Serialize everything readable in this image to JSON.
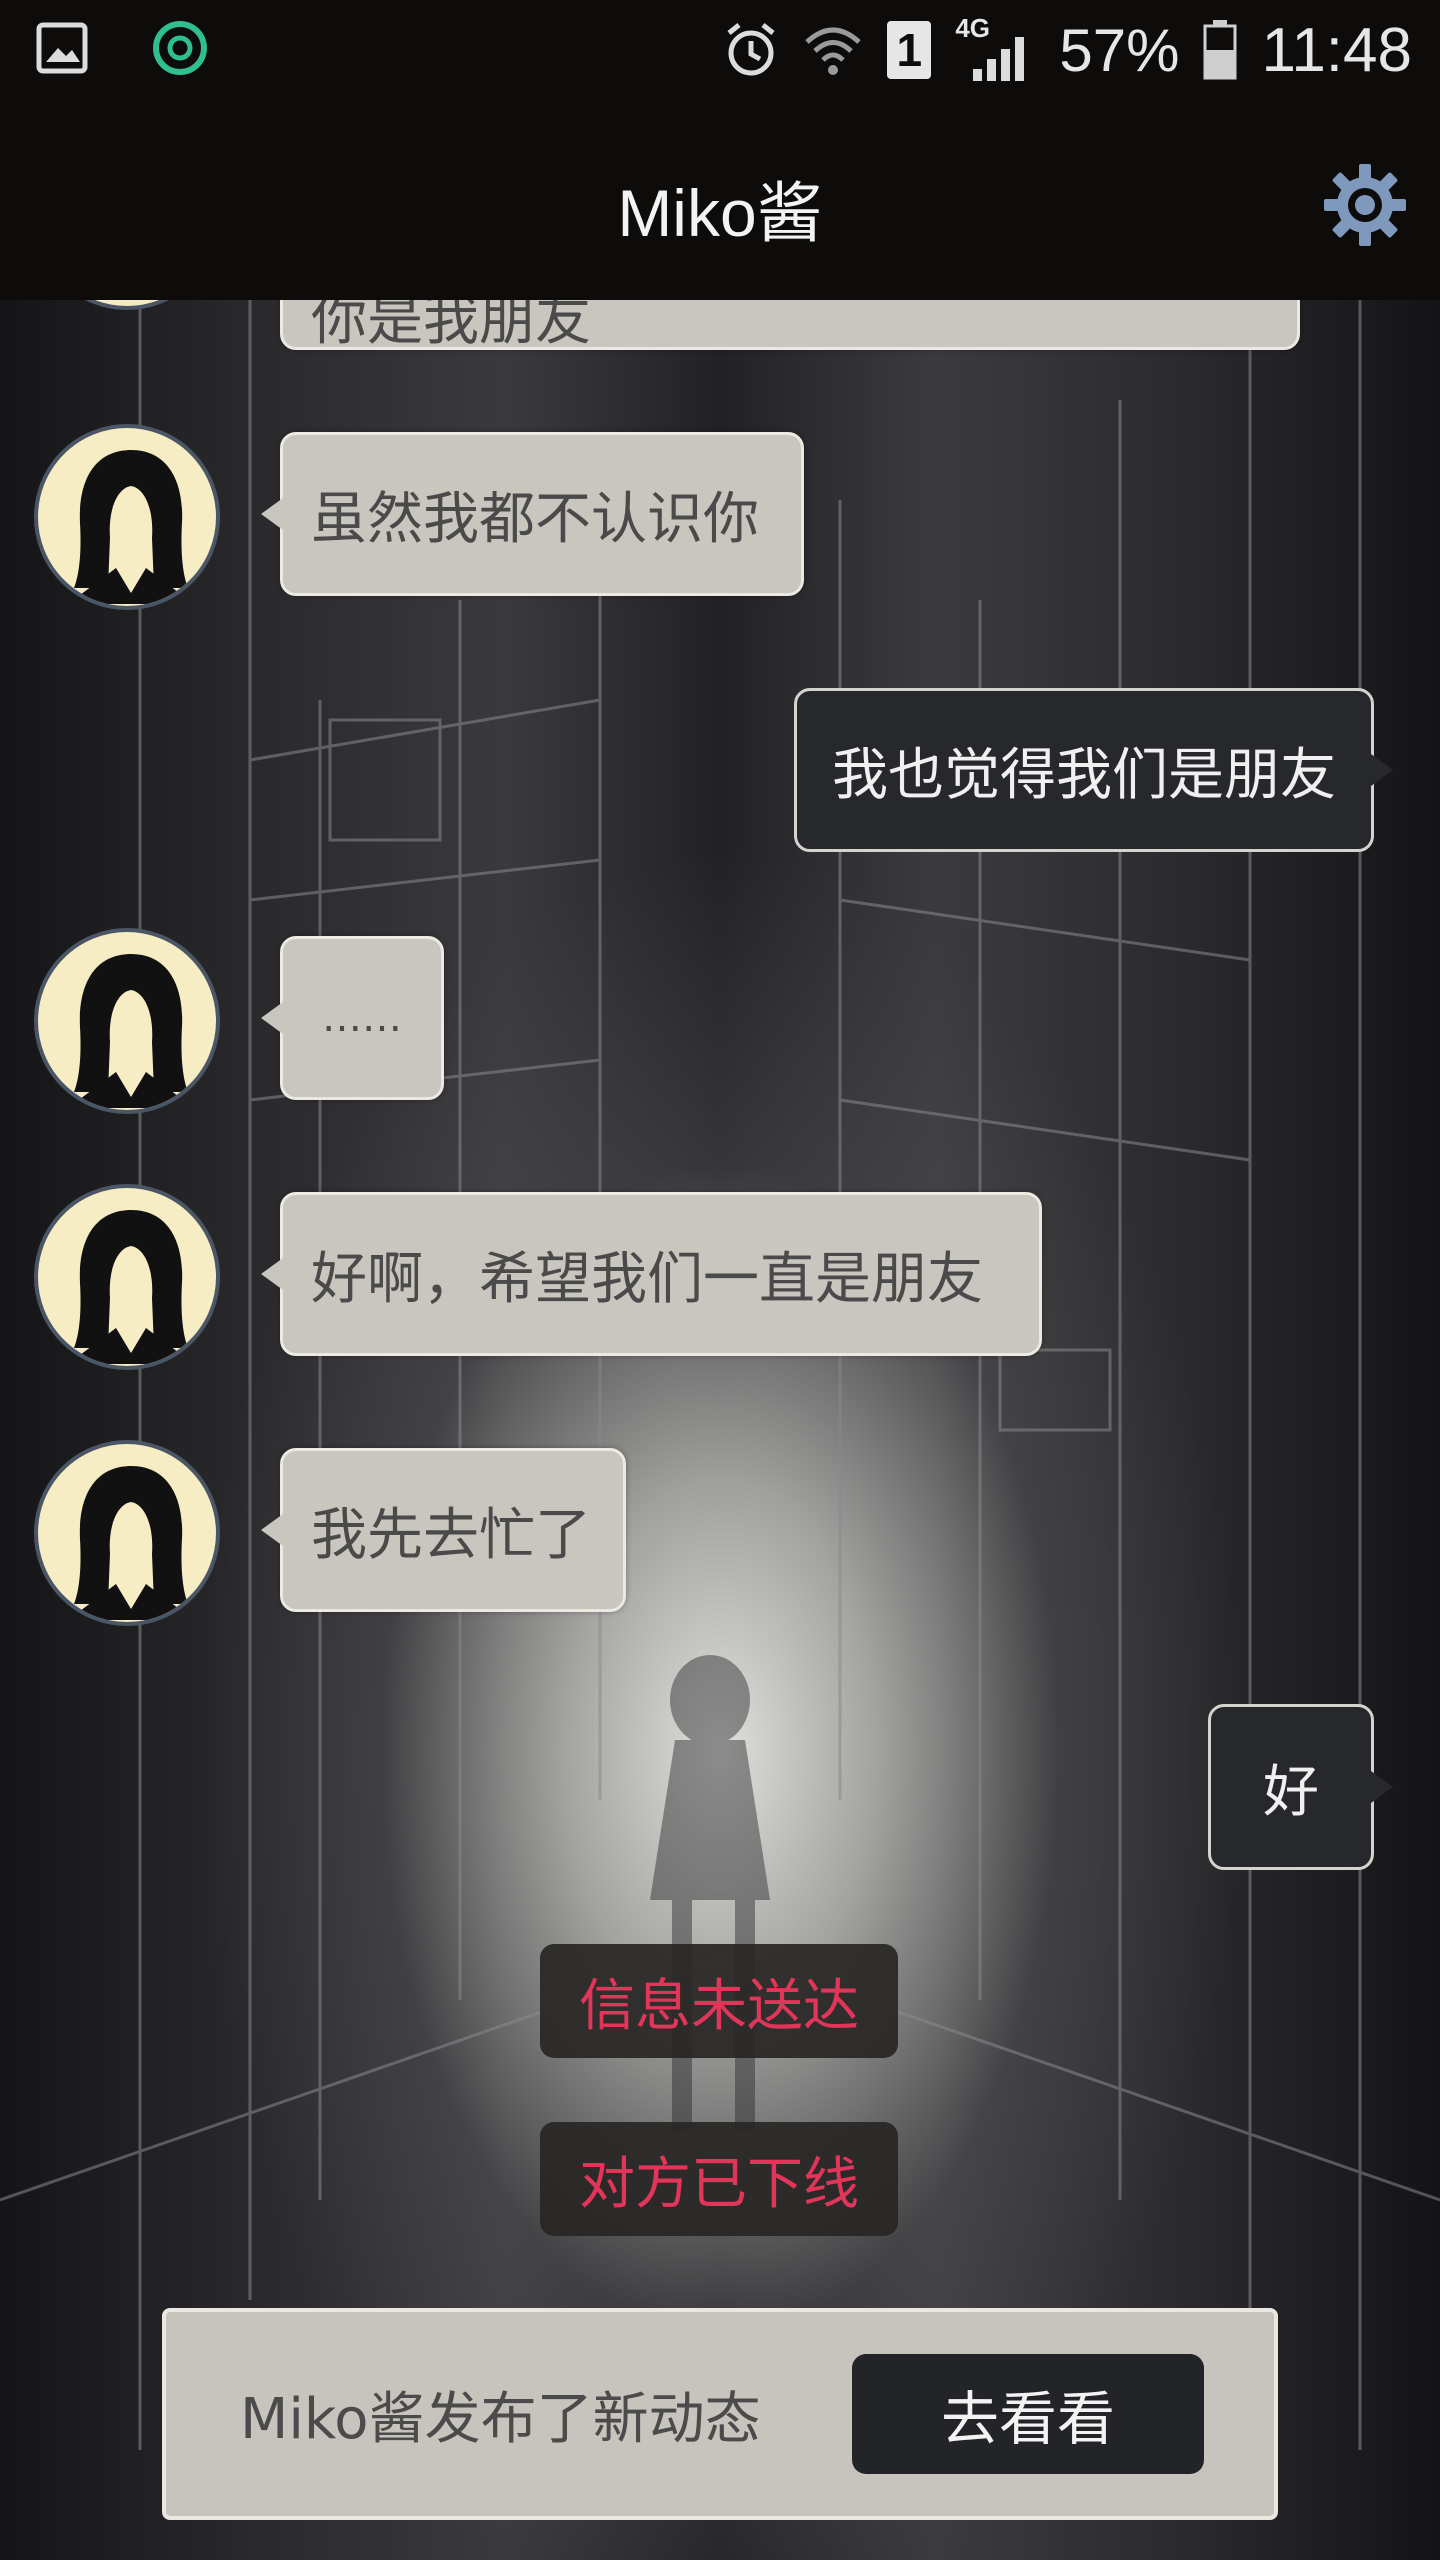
{
  "status_bar": {
    "battery": "57%",
    "time": "11:48",
    "network": "4G",
    "sim": "1"
  },
  "header": {
    "title": "Miko酱",
    "settings_icon": "gear-icon"
  },
  "messages": [
    {
      "from": "miko",
      "text": "你是我朋友"
    },
    {
      "from": "miko",
      "text": "虽然我都不认识你"
    },
    {
      "from": "me",
      "text": "我也觉得我们是朋友"
    },
    {
      "from": "miko",
      "text": "……"
    },
    {
      "from": "miko",
      "text": "好啊，希望我们一直是朋友"
    },
    {
      "from": "miko",
      "text": "我先去忙了"
    },
    {
      "from": "me",
      "text": "好"
    }
  ],
  "system_notes": [
    "信息未送达",
    "对方已下线"
  ],
  "notification": {
    "text": "Miko酱发布了新动态",
    "button": "去看看"
  },
  "colors": {
    "incoming_bubble": "#c9c6bf",
    "outgoing_bubble": "#26282c",
    "system_text": "#e2355a",
    "header_bg": "#0e0c0b"
  }
}
